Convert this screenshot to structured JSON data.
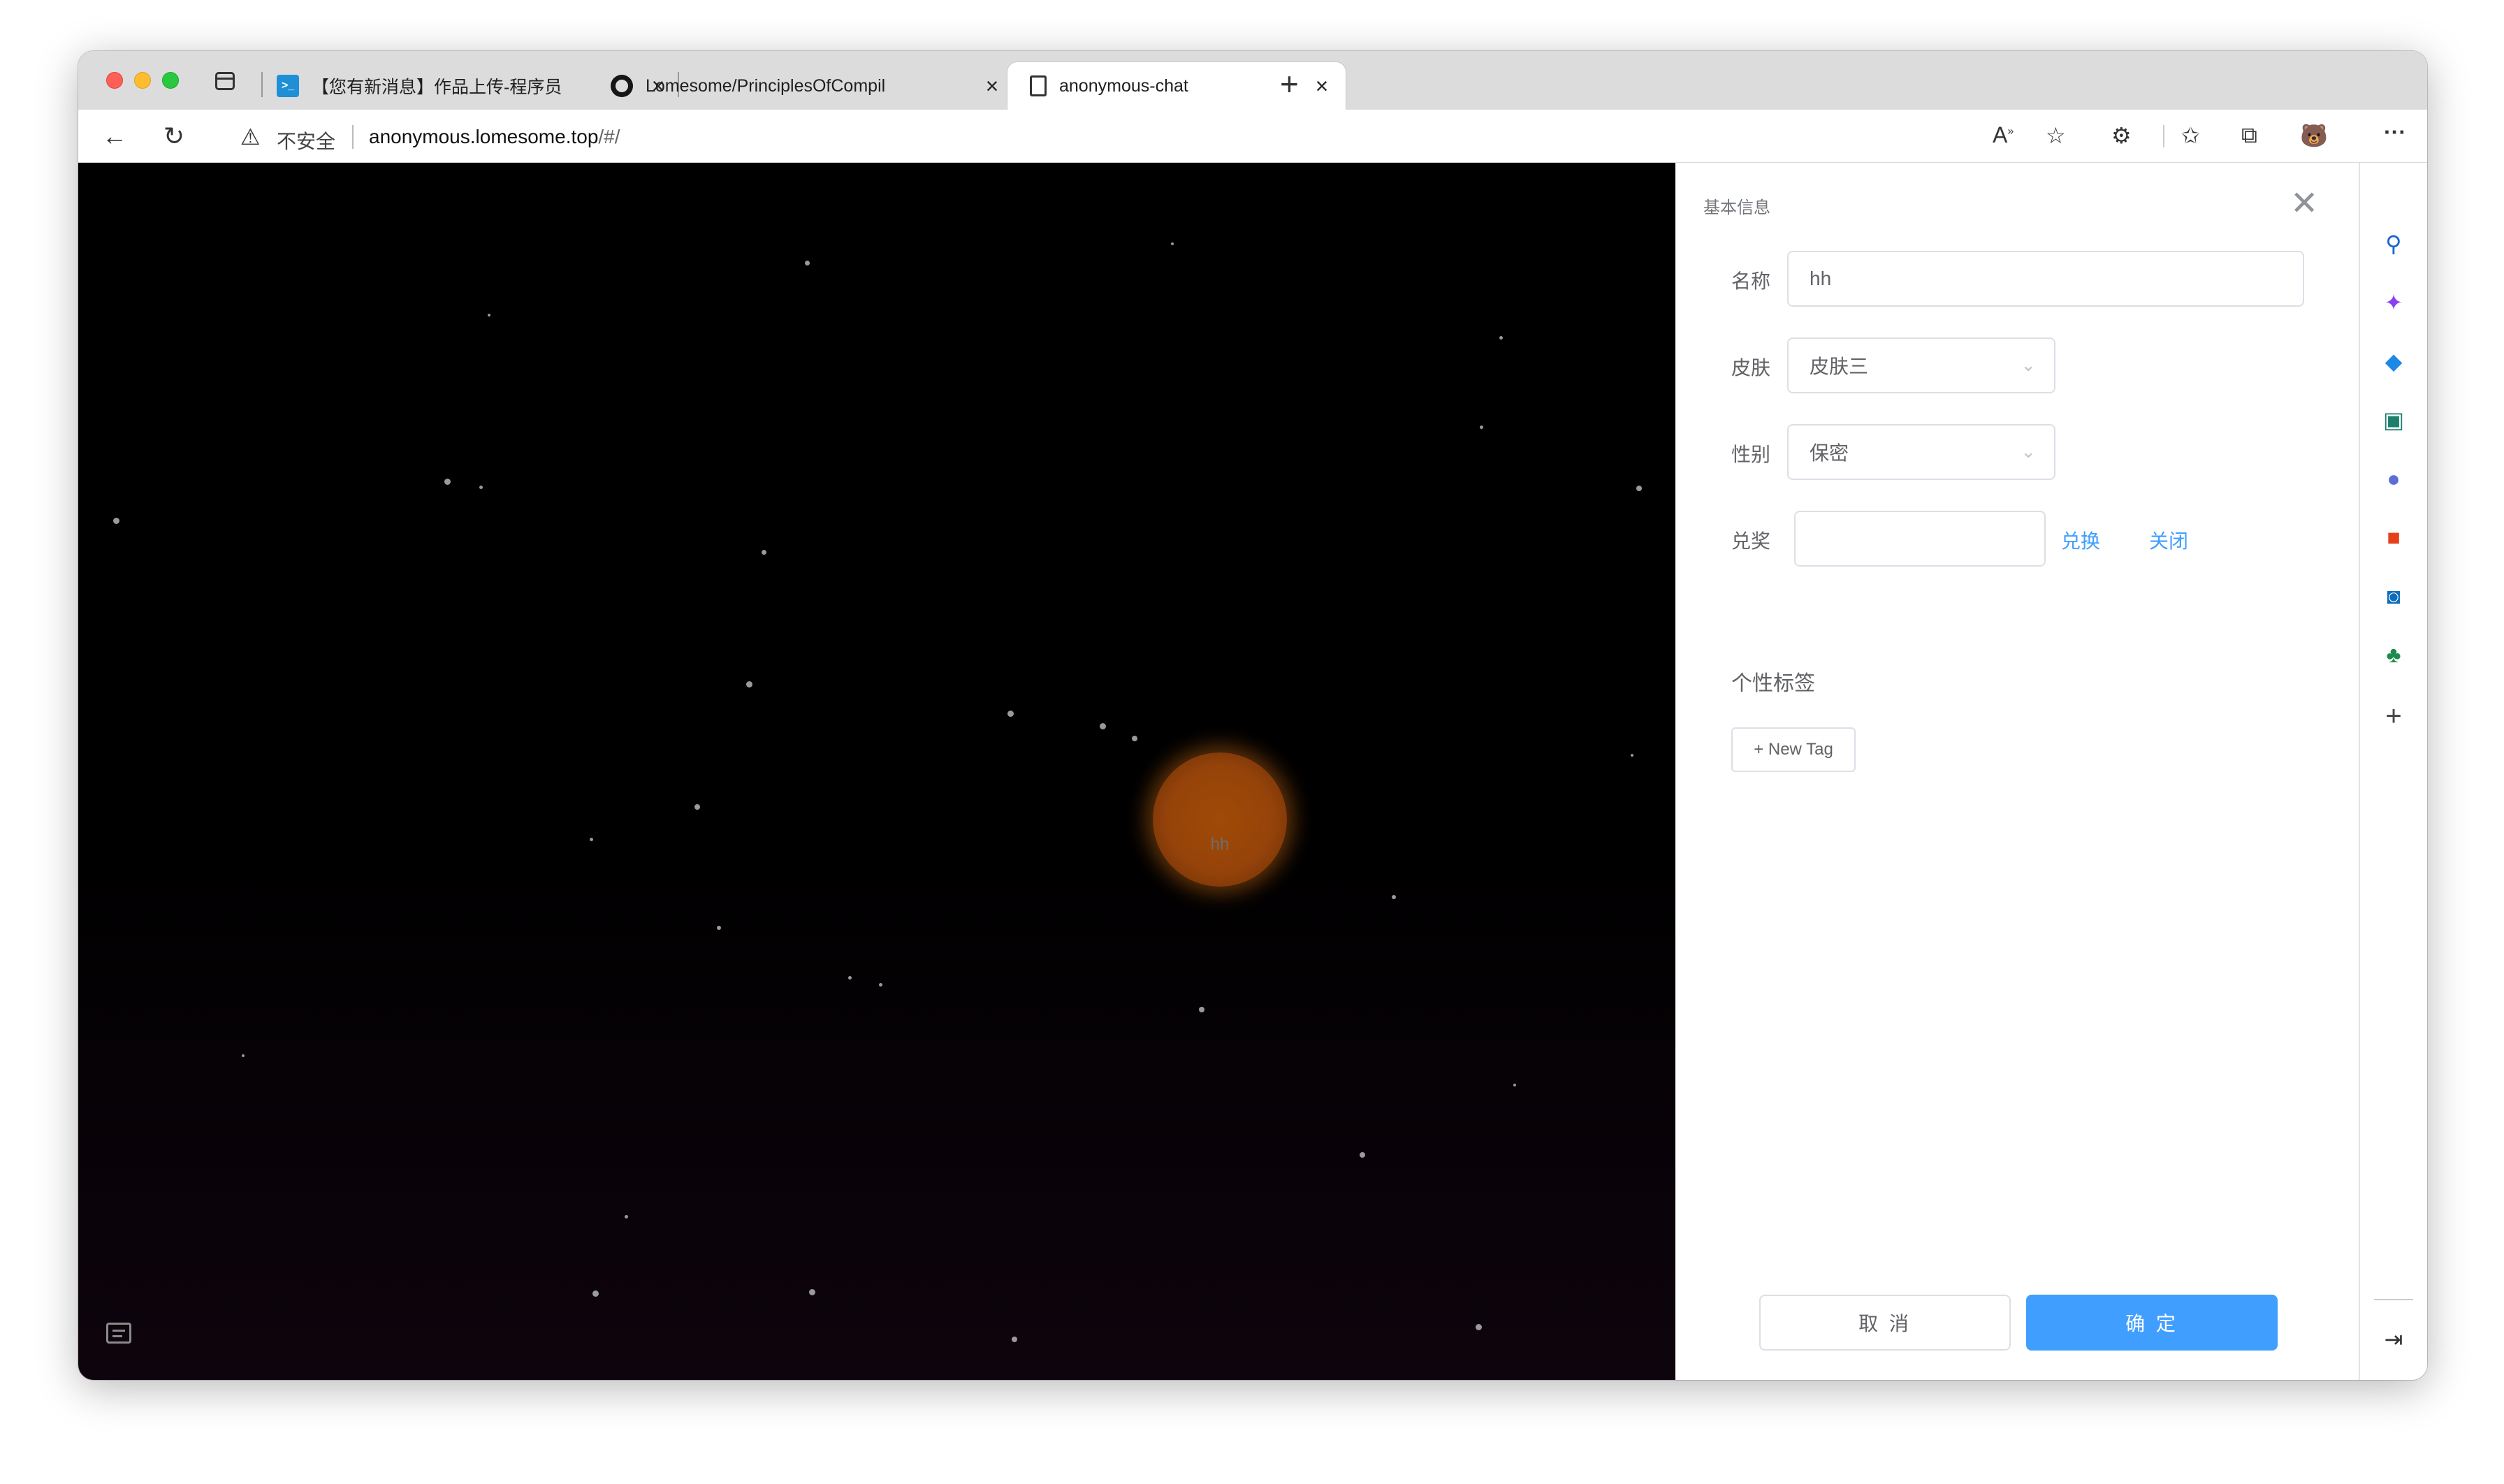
{
  "browser": {
    "tabs": [
      {
        "title": "【您有新消息】作品上传-程序员",
        "favicon": "terminal-icon",
        "active": false
      },
      {
        "title": "Lomesome/PrinciplesOfCompil",
        "favicon": "github-icon",
        "active": false
      },
      {
        "title": "anonymous-chat",
        "favicon": "page-icon",
        "active": true
      }
    ],
    "security_label": "不安全",
    "url_host": "anonymous.lomesome.top",
    "url_path": "/#/"
  },
  "scene": {
    "avatar_name": "hh",
    "avatar_color": "#a04a06"
  },
  "drawer": {
    "title": "基本信息",
    "name_label": "名称",
    "name_value": "hh",
    "skin_label": "皮肤",
    "skin_value": "皮肤三",
    "gender_label": "性别",
    "gender_value": "保密",
    "redeem_label": "兑奖",
    "redeem_value": "",
    "redeem_button": "兑换",
    "close_link": "关闭",
    "tags_title": "个性标签",
    "new_tag_button": "+ New Tag",
    "cancel_button": "取 消",
    "confirm_button": "确 定",
    "accent_color": "#409eff"
  },
  "sidebar": {
    "icons": [
      "search-icon",
      "copilot-icon",
      "shopping-icon",
      "tools-icon",
      "games-icon",
      "office-icon",
      "outlook-icon",
      "tree-icon",
      "add-icon",
      "split-screen-icon",
      "settings-icon"
    ]
  }
}
